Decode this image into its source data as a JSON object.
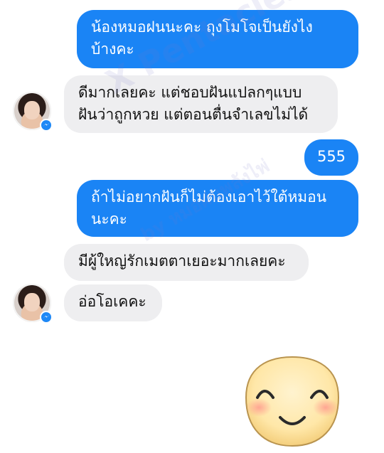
{
  "messages": [
    {
      "side": "out",
      "text": "น้องหมอฝนนะคะ  ถุงโมโจเป็นยังไง\nบ้างคะ"
    },
    {
      "side": "in",
      "text": "ดีมากเลยคะ แต่ชอบฝันแปลกๆแบบ\nฝันว่าถูกหวย แต่ตอนตื่นจำเลขไม่ได้"
    },
    {
      "side": "out",
      "text": "555"
    },
    {
      "side": "out",
      "text": "ถ้าไม่อยากฝันก็ไม่ต้องเอาไว้ใต้หมอน\nนะคะ"
    },
    {
      "side": "in",
      "text": "มีผู้ใหญ่รักเมตตาเยอะมากเลยคะ"
    },
    {
      "side": "in",
      "text": "อ่อโอเคคะ"
    }
  ],
  "watermark": {
    "line1": "X Pentacles",
    "line2": "by หมอฝนพลังไพ่"
  },
  "icons": {
    "avatar": "contact-avatar",
    "badge": "messenger-badge-icon",
    "sticker": "smiley-face-sticker"
  },
  "colors": {
    "outgoing_bubble": "#1a84f5",
    "incoming_bubble": "#eeeef0",
    "messenger_badge": "#1e88f6"
  }
}
